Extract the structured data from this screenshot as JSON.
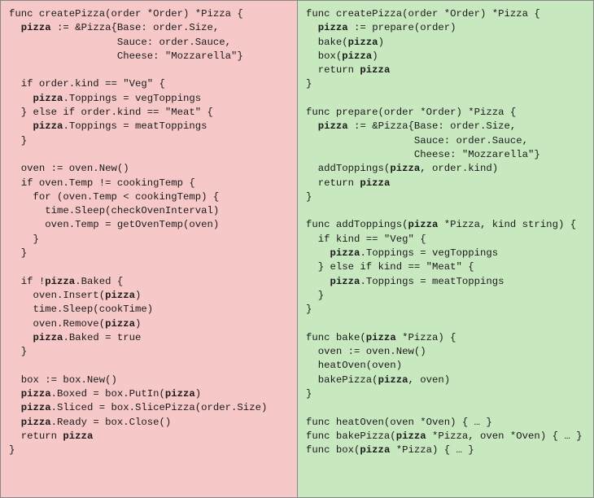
{
  "left": {
    "l01a": "func createPizza(order *Order) *Pizza {",
    "l02a": "  ",
    "l02b": "pizza",
    "l02c": " := &Pizza{Base: order.Size,",
    "l03a": "                  Sauce: order.Sauce,",
    "l04a": "                  Cheese: \"Mozzarella\"}",
    "l05a": "",
    "l06a": "  if order.kind == \"Veg\" {",
    "l07a": "    ",
    "l07b": "pizza",
    "l07c": ".Toppings = vegToppings",
    "l08a": "  } else if order.kind == \"Meat\" {",
    "l09a": "    ",
    "l09b": "pizza",
    "l09c": ".Toppings = meatToppings",
    "l10a": "  }",
    "l11a": "",
    "l12a": "  oven := oven.New()",
    "l13a": "  if oven.Temp != cookingTemp {",
    "l14a": "    for (oven.Temp < cookingTemp) {",
    "l15a": "      time.Sleep(checkOvenInterval)",
    "l16a": "      oven.Temp = getOvenTemp(oven)",
    "l17a": "    }",
    "l18a": "  }",
    "l19a": "",
    "l20a": "  if !",
    "l20b": "pizza",
    "l20c": ".Baked {",
    "l21a": "    oven.Insert(",
    "l21b": "pizza",
    "l21c": ")",
    "l22a": "    time.Sleep(cookTime)",
    "l23a": "    oven.Remove(",
    "l23b": "pizza",
    "l23c": ")",
    "l24a": "    ",
    "l24b": "pizza",
    "l24c": ".Baked = true",
    "l25a": "  }",
    "l26a": "",
    "l27a": "  box := box.New()",
    "l28a": "  ",
    "l28b": "pizza",
    "l28c": ".Boxed = box.PutIn(",
    "l28d": "pizza",
    "l28e": ")",
    "l29a": "  ",
    "l29b": "pizza",
    "l29c": ".Sliced = box.SlicePizza(order.Size)",
    "l30a": "  ",
    "l30b": "pizza",
    "l30c": ".Ready = box.Close()",
    "l31a": "  return ",
    "l31b": "pizza",
    "l32a": "}"
  },
  "right": {
    "r01a": "func createPizza(order *Order) *Pizza {",
    "r02a": "  ",
    "r02b": "pizza",
    "r02c": " := prepare(order)",
    "r03a": "  bake(",
    "r03b": "pizza",
    "r03c": ")",
    "r04a": "  box(",
    "r04b": "pizza",
    "r04c": ")",
    "r05a": "  return ",
    "r05b": "pizza",
    "r06a": "}",
    "r07a": "",
    "r08a": "func prepare(order *Order) *Pizza {",
    "r09a": "  ",
    "r09b": "pizza",
    "r09c": " := &Pizza{Base: order.Size,",
    "r10a": "                  Sauce: order.Sauce,",
    "r11a": "                  Cheese: \"Mozzarella\"}",
    "r12a": "  addToppings(",
    "r12b": "pizza",
    "r12c": ", order.kind)",
    "r13a": "  return ",
    "r13b": "pizza",
    "r14a": "}",
    "r15a": "",
    "r16a": "func addToppings(",
    "r16b": "pizza",
    "r16c": " *Pizza, kind string) {",
    "r17a": "  if kind == \"Veg\" {",
    "r18a": "    ",
    "r18b": "pizza",
    "r18c": ".Toppings = vegToppings",
    "r19a": "  } else if kind == \"Meat\" {",
    "r20a": "    ",
    "r20b": "pizza",
    "r20c": ".Toppings = meatToppings",
    "r21a": "  }",
    "r22a": "}",
    "r23a": "",
    "r24a": "func bake(",
    "r24b": "pizza",
    "r24c": " *Pizza) {",
    "r25a": "  oven := oven.New()",
    "r26a": "  heatOven(oven)",
    "r27a": "  bakePizza(",
    "r27b": "pizza",
    "r27c": ", oven)",
    "r28a": "}",
    "r29a": "",
    "r30a": "func heatOven(oven *Oven) { … }",
    "r31a": "func bakePizza(",
    "r31b": "pizza",
    "r31c": " *Pizza, oven *Oven) { … }",
    "r32a": "func box(",
    "r32b": "pizza",
    "r32c": " *Pizza) { … }"
  }
}
